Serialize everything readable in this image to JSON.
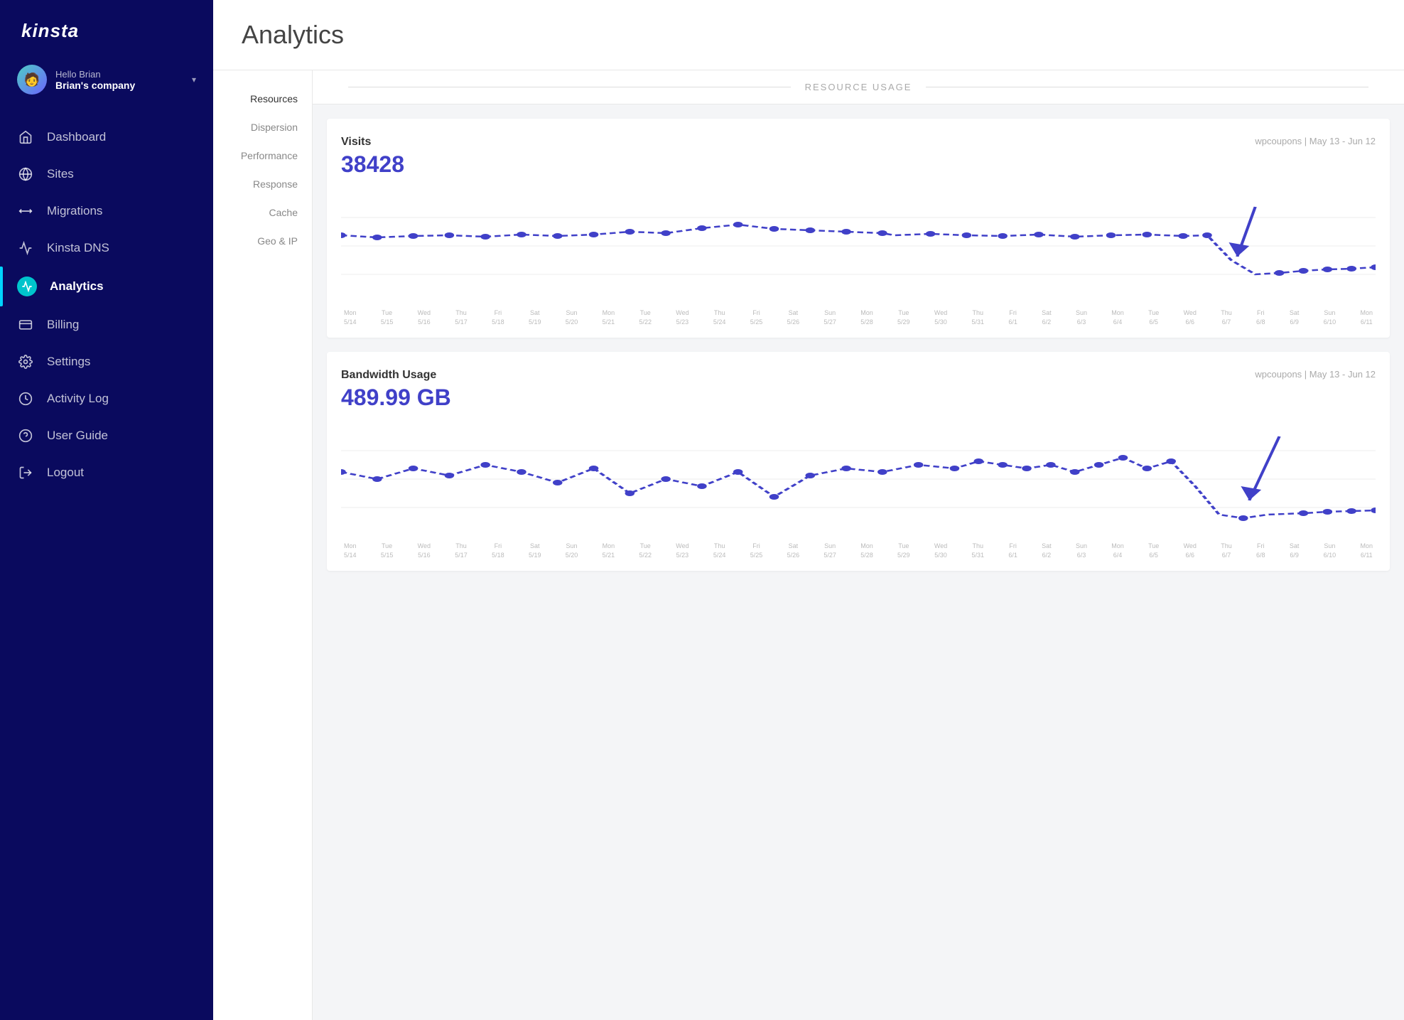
{
  "sidebar": {
    "logo": "kinsta",
    "user": {
      "hello": "Hello Brian",
      "company": "Brian's company"
    },
    "nav_items": [
      {
        "id": "dashboard",
        "label": "Dashboard",
        "icon": "home"
      },
      {
        "id": "sites",
        "label": "Sites",
        "icon": "sites"
      },
      {
        "id": "migrations",
        "label": "Migrations",
        "icon": "migrations"
      },
      {
        "id": "kinsta-dns",
        "label": "Kinsta DNS",
        "icon": "dns"
      },
      {
        "id": "analytics",
        "label": "Analytics",
        "icon": "analytics",
        "active": true
      },
      {
        "id": "billing",
        "label": "Billing",
        "icon": "billing"
      },
      {
        "id": "settings",
        "label": "Settings",
        "icon": "settings"
      },
      {
        "id": "activity-log",
        "label": "Activity Log",
        "icon": "activity"
      },
      {
        "id": "user-guide",
        "label": "User Guide",
        "icon": "guide"
      },
      {
        "id": "logout",
        "label": "Logout",
        "icon": "logout"
      }
    ]
  },
  "page": {
    "title": "Analytics"
  },
  "sub_nav": {
    "items": [
      {
        "id": "resources",
        "label": "Resources",
        "active": true
      },
      {
        "id": "dispersion",
        "label": "Dispersion"
      },
      {
        "id": "performance",
        "label": "Performance"
      },
      {
        "id": "response",
        "label": "Response"
      },
      {
        "id": "cache",
        "label": "Cache"
      },
      {
        "id": "geo-ip",
        "label": "Geo & IP"
      }
    ]
  },
  "resource_usage": {
    "section_title": "RESOURCE USAGE",
    "charts": [
      {
        "id": "visits",
        "label": "Visits",
        "value": "38428",
        "meta": "wpcoupons | May 13 - Jun 12",
        "color": "#4040c8"
      },
      {
        "id": "bandwidth",
        "label": "Bandwidth Usage",
        "value": "489.99 GB",
        "meta": "wpcoupons | May 13 - Jun 12",
        "color": "#4040c8"
      }
    ],
    "dates": [
      "Mon\n5/14",
      "Tue\n5/15",
      "Wed\n5/16",
      "Thu\n5/17",
      "Fri\n5/18",
      "Sat\n5/19",
      "Sun\n5/20",
      "Mon\n5/21",
      "Tue\n5/22",
      "Wed\n5/23",
      "Thu\n5/24",
      "Fri\n5/25",
      "Sat\n5/26",
      "Sun\n5/27",
      "Mon\n5/28",
      "Tue\n5/29",
      "Wed\n5/30",
      "Thu\n5/31",
      "Fri\n6/1",
      "Sat\n6/2",
      "Sun\n6/3",
      "Mon\n6/4",
      "Tue\n6/5",
      "Wed\n6/6",
      "Thu\n6/7",
      "Fri\n6/8",
      "Sat\n6/9",
      "Sun\n6/10",
      "Mon\n6/11"
    ]
  }
}
